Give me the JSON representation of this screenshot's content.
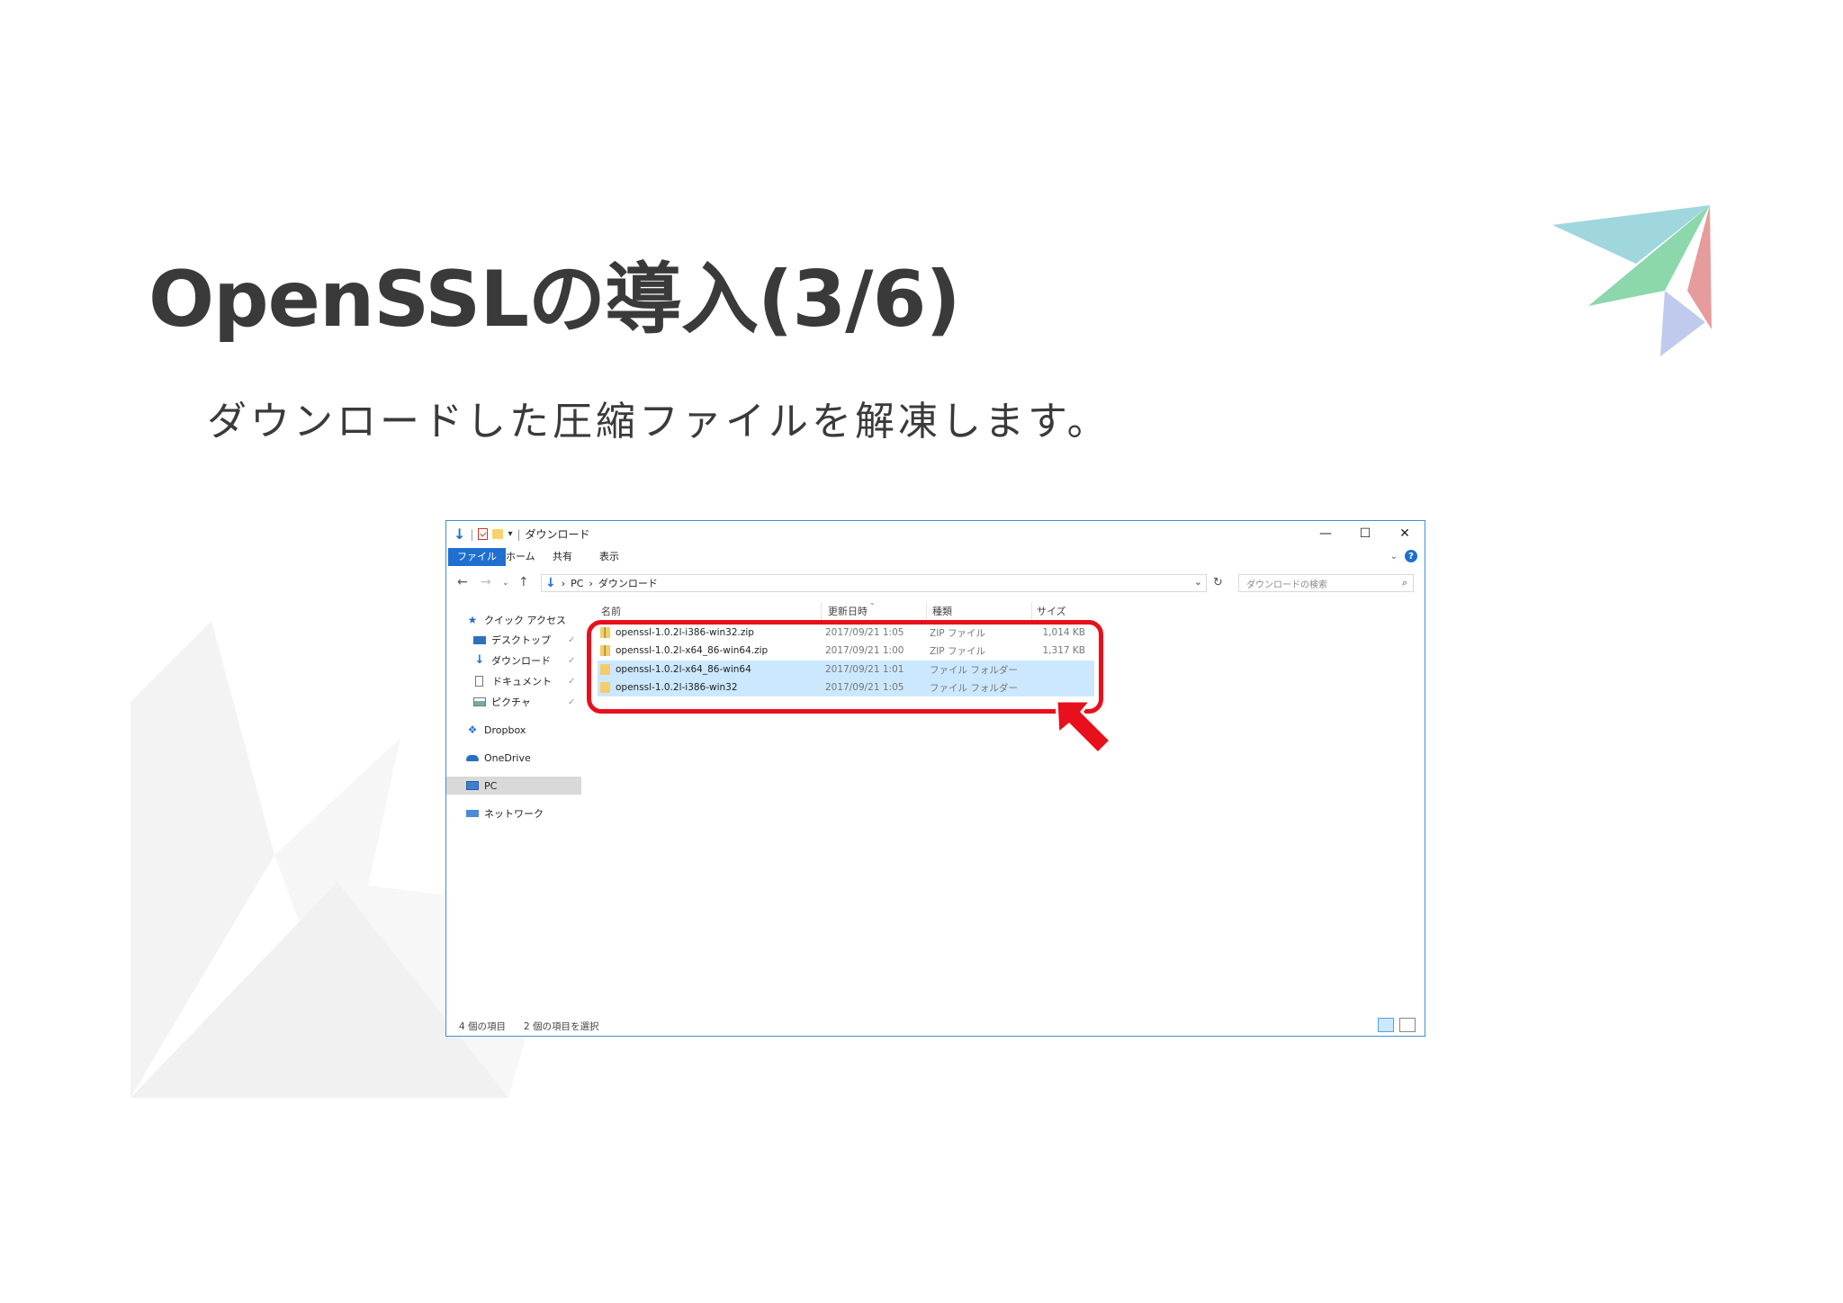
{
  "slide": {
    "title": "OpenSSLの導入(3/6)",
    "subtitle": "ダウンロードした圧縮ファイルを解凍します。"
  },
  "explorer": {
    "window_title": "ダウンロード",
    "window_controls": {
      "minimize": "—",
      "maximize": "☐",
      "close": "✕"
    },
    "ribbon_tabs": [
      "ファイル",
      "ホーム",
      "共有",
      "表示"
    ],
    "address": {
      "root": "PC",
      "separator": "›",
      "current": "ダウンロード"
    },
    "search_placeholder": "ダウンロードの検索",
    "nav": {
      "quick_access": "クイック アクセス",
      "desktop": "デスクトップ",
      "downloads": "ダウンロード",
      "documents": "ドキュメント",
      "pictures": "ピクチャ",
      "dropbox": "Dropbox",
      "onedrive": "OneDrive",
      "pc": "PC",
      "network": "ネットワーク"
    },
    "columns": {
      "name": "名前",
      "date": "更新日時",
      "type": "種類",
      "size": "サイズ"
    },
    "files": [
      {
        "name": "openssl-1.0.2l-i386-win32.zip",
        "date": "2017/09/21 1:05",
        "type": "ZIP ファイル",
        "size": "1,014 KB",
        "icon": "zip-icon",
        "selected": false
      },
      {
        "name": "openssl-1.0.2l-x64_86-win64.zip",
        "date": "2017/09/21 1:00",
        "type": "ZIP ファイル",
        "size": "1,317 KB",
        "icon": "zip-icon",
        "selected": false
      },
      {
        "name": "openssl-1.0.2l-x64_86-win64",
        "date": "2017/09/21 1:01",
        "type": "ファイル フォルダー",
        "size": "",
        "icon": "folder-icon",
        "selected": true
      },
      {
        "name": "openssl-1.0.2l-i386-win32",
        "date": "2017/09/21 1:05",
        "type": "ファイル フォルダー",
        "size": "",
        "icon": "folder-icon",
        "selected": true
      }
    ],
    "status": {
      "item_count": "4 個の項目",
      "selected_count": "2 個の項目を選択"
    }
  },
  "colors": {
    "title_text": "#3a3a3a",
    "window_border": "#3c8fd6",
    "accent_blue": "#1f6fd1",
    "selection": "#cce8ff",
    "highlight_red": "#e8101d"
  }
}
